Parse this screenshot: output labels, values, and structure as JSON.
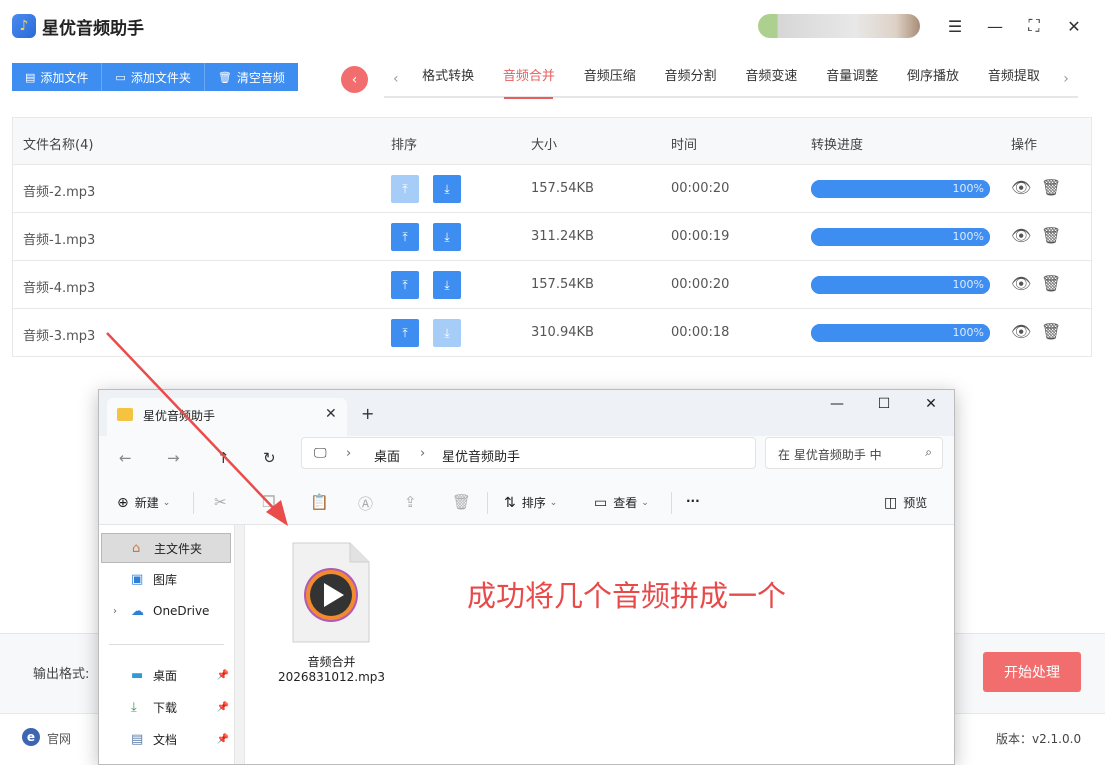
{
  "app": {
    "title": "星优音频助手",
    "logo_icon": "music-note-icon"
  },
  "toolbar": {
    "add_file": "添加文件",
    "add_folder": "添加文件夹",
    "clear_audio": "清空音频"
  },
  "tabs": [
    {
      "label": "格式转换",
      "active": false
    },
    {
      "label": "音频合并",
      "active": true
    },
    {
      "label": "音频压缩",
      "active": false
    },
    {
      "label": "音频分割",
      "active": false
    },
    {
      "label": "音频变速",
      "active": false
    },
    {
      "label": "音量调整",
      "active": false
    },
    {
      "label": "倒序播放",
      "active": false
    },
    {
      "label": "音频提取",
      "active": false
    }
  ],
  "table": {
    "headers": {
      "name": "文件名称(4)",
      "sort": "排序",
      "size": "大小",
      "time": "时间",
      "progress": "转换进度",
      "ops": "操作"
    },
    "rows": [
      {
        "name": "音频-2.mp3",
        "size": "157.54KB",
        "time": "00:00:20",
        "progress": "100%",
        "up_enabled": false,
        "down_enabled": true
      },
      {
        "name": "音频-1.mp3",
        "size": "311.24KB",
        "time": "00:00:19",
        "progress": "100%",
        "up_enabled": true,
        "down_enabled": true
      },
      {
        "name": "音频-4.mp3",
        "size": "157.54KB",
        "time": "00:00:20",
        "progress": "100%",
        "up_enabled": true,
        "down_enabled": true
      },
      {
        "name": "音频-3.mp3",
        "size": "310.94KB",
        "time": "00:00:18",
        "progress": "100%",
        "up_enabled": true,
        "down_enabled": false
      }
    ]
  },
  "bottom": {
    "output_format_label": "输出格式:",
    "start_button": "开始处理",
    "site_label": "官网",
    "version": "版本：v2.1.0.0"
  },
  "explorer": {
    "tab_title": "星优音频助手",
    "breadcrumbs": [
      "桌面",
      "星优音频助手"
    ],
    "search_placeholder": "在 星优音频助手 中",
    "commands": {
      "new": "新建",
      "sort": "排序",
      "view": "查看",
      "more": "···",
      "preview": "预览"
    },
    "sidebar": [
      {
        "label": "主文件夹",
        "icon": "home-icon",
        "selected": true,
        "pinned": false
      },
      {
        "label": "图库",
        "icon": "gallery-icon",
        "selected": false,
        "pinned": false
      },
      {
        "label": "OneDrive",
        "icon": "cloud-icon",
        "selected": false,
        "pinned": false
      },
      {
        "label": "桌面",
        "icon": "desktop-icon",
        "selected": false,
        "pinned": true
      },
      {
        "label": "下载",
        "icon": "download-icon",
        "selected": false,
        "pinned": true
      },
      {
        "label": "文档",
        "icon": "document-icon",
        "selected": false,
        "pinned": true
      }
    ],
    "file": {
      "name_line1": "音频合并",
      "name_line2": "2026831012.mp3",
      "icon": "media-play-file-icon"
    }
  },
  "annotation": "成功将几个音频拼成一个",
  "colors": {
    "primary": "#3e8df0",
    "accent_red": "#f26e6e",
    "annotation_red": "#e84a4a"
  }
}
